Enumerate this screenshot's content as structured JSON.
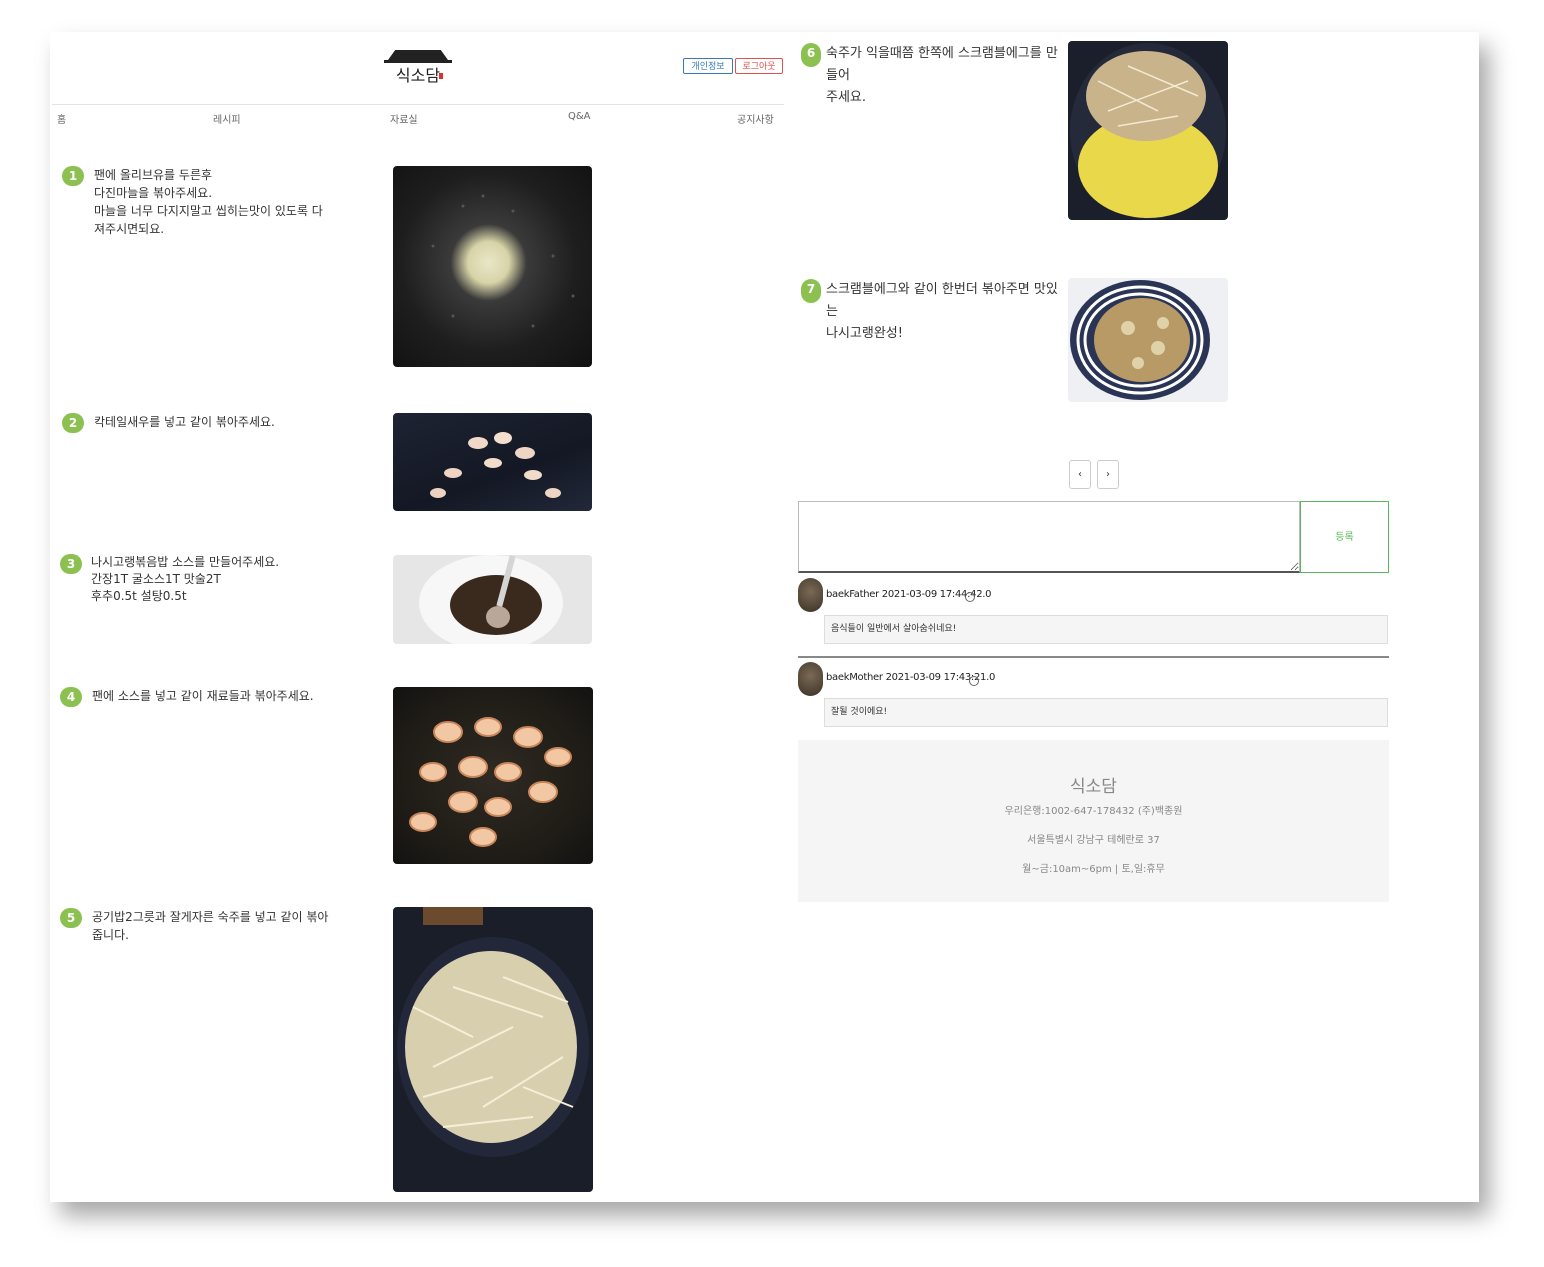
{
  "header": {
    "logo_text": "식소담",
    "buttons": {
      "info": "개인정보",
      "logout": "로그아웃"
    }
  },
  "nav": [
    "홈",
    "레시피",
    "자료실",
    "Q&A",
    "공지사항"
  ],
  "steps": [
    {
      "num": "1",
      "text": "팬에 올리브유를 두른후\n다진마늘을 볶아주세요.\n마늘을 너무 다지지말고 씹히는맛이 있도록 다\n져주시면되요."
    },
    {
      "num": "2",
      "text": "칵테일새우를 넣고 같이 볶아주세요."
    },
    {
      "num": "3",
      "text": "나시고랭볶음밥 소스를 만들어주세요.\n간장1T 굴소스1T 맛술2T\n후추0.5t 설탕0.5t"
    },
    {
      "num": "4",
      "text": "팬에 소스를 넣고 같이 재료들과 볶아주세요."
    },
    {
      "num": "5",
      "text": "공기밥2그릇과 잘게자른 숙주를 넣고 같이 볶아\n줍니다."
    },
    {
      "num": "6",
      "text": "숙주가 익을때쯤 한쪽에 스크램블에그를 만들어\n주세요."
    },
    {
      "num": "7",
      "text": "스크램블에그와 같이 한번더 볶아주면 맛있는\n나시고랭완성!"
    }
  ],
  "pager": {
    "prev": "‹",
    "next": "›"
  },
  "comment_form": {
    "textarea_value": "",
    "submit_label": "등록"
  },
  "comments": [
    {
      "author": "baekFather",
      "timestamp": "2021-03-09 17:44:42.0",
      "text": "음식들이 일반에서 살아숨쉬네요!"
    },
    {
      "author": "baekMother",
      "timestamp": "2021-03-09 17:43:21.0",
      "text": "잘될 것이에요!"
    }
  ],
  "footer": {
    "title": "식소담",
    "bank": "우리은행:1002-647-178432 (주)백종원",
    "address": "서울특별시 강남구 테헤란로 37",
    "hours": "월~금:10am~6pm | 토,일:휴무"
  },
  "colors": {
    "accent_green": "#8cc152",
    "info_blue": "#337ab7",
    "logout_red": "#d9534f",
    "register_green": "#5cb85c"
  }
}
